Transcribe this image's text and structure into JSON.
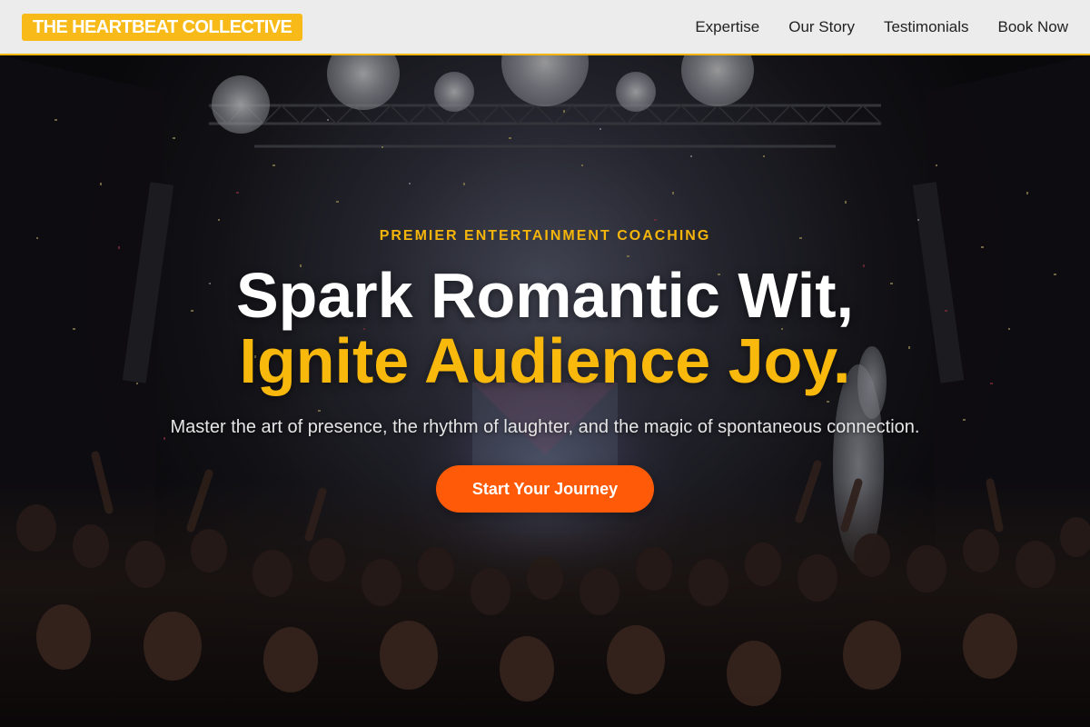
{
  "brand": {
    "name": "THE HEARTBEAT COLLECTIVE"
  },
  "nav": {
    "items": [
      {
        "label": "Expertise"
      },
      {
        "label": "Our Story"
      },
      {
        "label": "Testimonials"
      },
      {
        "label": "Book Now"
      }
    ]
  },
  "hero": {
    "eyebrow": "PREMIER ENTERTAINMENT COACHING",
    "headline_line1": "Spark Romantic Wit,",
    "headline_line2": "Ignite Audience Joy.",
    "subheadline": "Master the art of presence, the rhythm of laughter, and the magic of spontaneous connection.",
    "cta_label": "Start Your Journey",
    "background_icon": "concert-crowd-confetti-photo"
  },
  "colors": {
    "accent": "#f8ba18",
    "cta": "#ff5a07",
    "nav_bg": "#ececec",
    "hero_text": "#ffffff"
  }
}
